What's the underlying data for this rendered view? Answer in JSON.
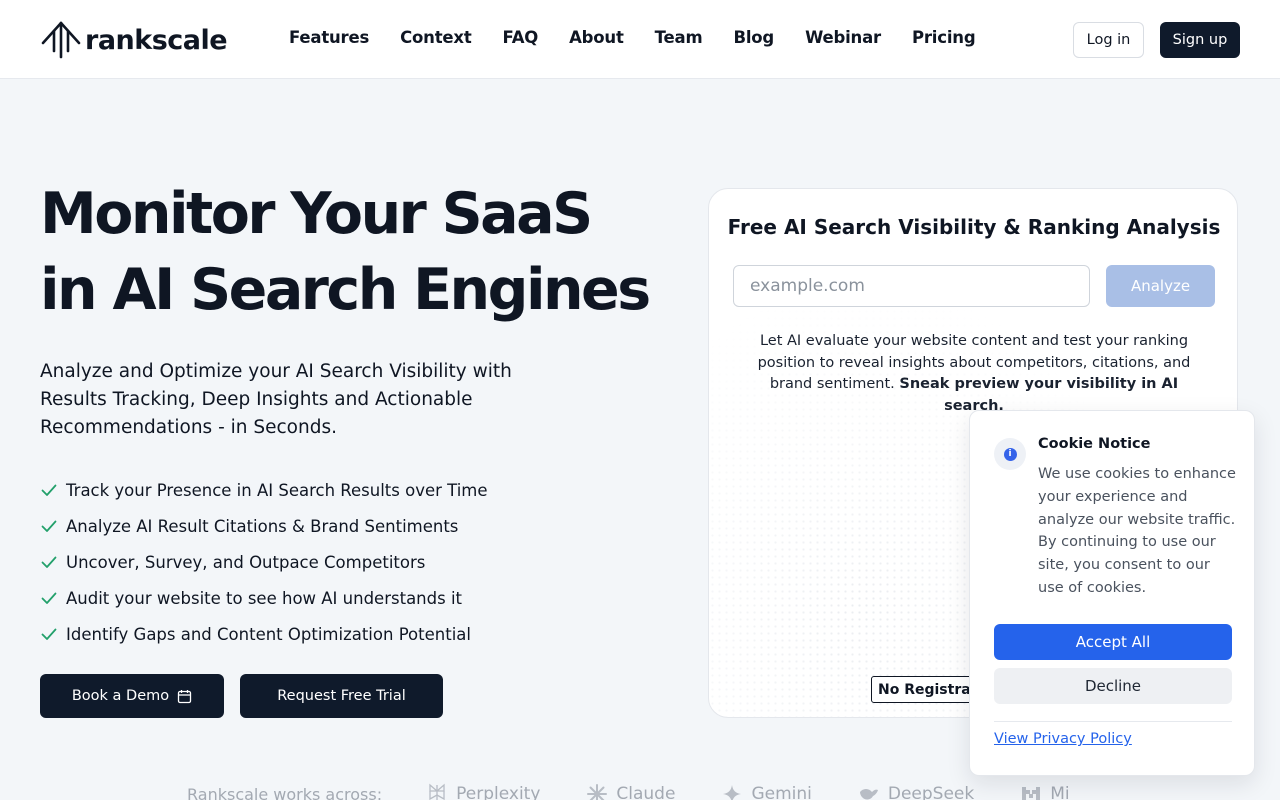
{
  "brand": {
    "name": "rankscale"
  },
  "nav": {
    "items": [
      {
        "label": "Features"
      },
      {
        "label": "Context"
      },
      {
        "label": "FAQ"
      },
      {
        "label": "About"
      },
      {
        "label": "Team"
      },
      {
        "label": "Blog"
      },
      {
        "label": "Webinar"
      },
      {
        "label": "Pricing"
      }
    ],
    "login_label": "Log in",
    "signup_label": "Sign up"
  },
  "hero": {
    "title_line1": "Monitor Your SaaS",
    "title_line2": "in AI Search Engines",
    "subtitle": "Analyze and Optimize your AI Search Visibility with Results Tracking, Deep Insights and Actionable Recommendations - in Seconds.",
    "features": [
      "Track your Presence in AI Search Results over Time",
      "Analyze AI Result Citations & Brand Sentiments",
      "Uncover, Survey, and Outpace Competitors",
      "Audit your website to see how AI understands it",
      "Identify Gaps and Content Optimization Potential"
    ],
    "demo_label": "Book a Demo",
    "trial_label": "Request Free Trial"
  },
  "analysis": {
    "title": "Free AI Search Visibility & Ranking Analysis",
    "input_placeholder": "example.com",
    "analyze_label": "Analyze",
    "description": "Let AI evaluate your website content and test your ranking position to reveal insights about competitors, citations, and brand sentiment.",
    "description_bold": "Sneak preview your visibility in AI search.",
    "badge": "No Registration"
  },
  "works_across": {
    "label": "Rankscale works across:",
    "engines": [
      {
        "name": "Perplexity",
        "icon": "perplexity-icon"
      },
      {
        "name": "Claude",
        "icon": "claude-icon"
      },
      {
        "name": "Gemini",
        "icon": "gemini-icon"
      },
      {
        "name": "DeepSeek",
        "icon": "deepseek-icon"
      },
      {
        "name": "Mi",
        "icon": "mistral-icon"
      }
    ]
  },
  "cookie": {
    "title": "Cookie Notice",
    "text": "We use cookies to enhance your experience and analyze our website traffic. By continuing to use our site, you consent to our use of cookies.",
    "accept_label": "Accept All",
    "decline_label": "Decline",
    "privacy_label": "View Privacy Policy"
  },
  "colors": {
    "primary_dark": "#0f1a2b",
    "accent_blue": "#2563eb",
    "analyze_disabled": "#a9bfe6",
    "check_green": "#22a06b",
    "page_bg": "#f3f6f9"
  }
}
